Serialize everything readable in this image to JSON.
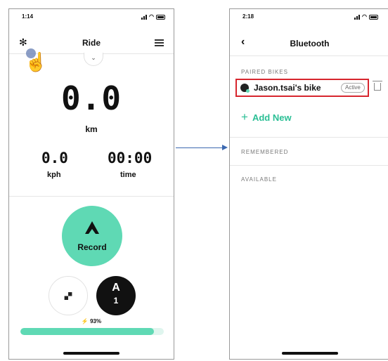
{
  "ride_screen": {
    "time": "1:14",
    "title": "Ride",
    "distance": "0.0",
    "distance_unit": "km",
    "speed": "0.0",
    "speed_unit": "kph",
    "duration": "00:00",
    "duration_label": "time",
    "record_label": "Record",
    "auto_letter": "A",
    "auto_number": "1",
    "charge": "93%",
    "charge_level": 0.93
  },
  "bluetooth_screen": {
    "time": "2:18",
    "title": "Bluetooth",
    "paired_header": "PAIRED BIKES",
    "bike_name": "Jason.tsai's bike",
    "bike_status": "Active",
    "add_new": "Add New",
    "remembered_header": "REMEMBERED",
    "available_header": "AVAILABLE"
  },
  "colors": {
    "accent": "#5fd9b4",
    "highlight_box": "#d7262e",
    "flow_arrow": "#3b68b0"
  }
}
